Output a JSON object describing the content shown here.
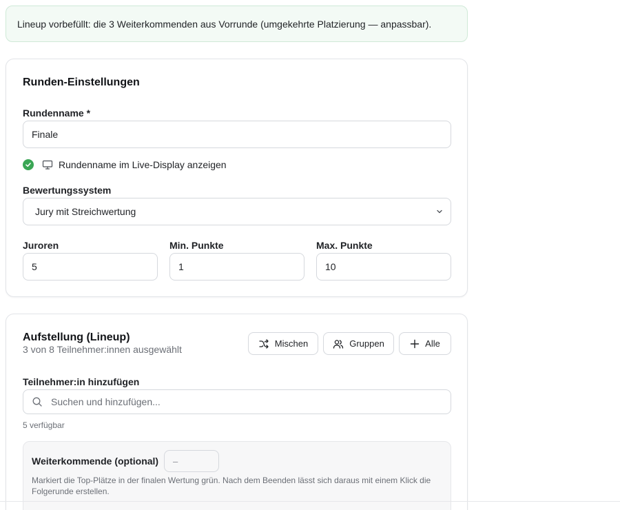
{
  "notice": {
    "text": "Lineup vorbefüllt: die 3 Weiterkommenden aus Vorrunde (umgekehrte Platzierung — anpassbar)."
  },
  "settings": {
    "title": "Runden-Einstellungen",
    "round_name_label": "Rundenname *",
    "round_name_value": "Finale",
    "show_in_display_label": "Rundenname im Live-Display anzeigen",
    "show_in_display_checked": true,
    "scoring_label": "Bewertungssystem",
    "scoring_value": "Jury mit Streichwertung",
    "judges_label": "Juroren",
    "judges_value": "5",
    "min_points_label": "Min. Punkte",
    "min_points_value": "1",
    "max_points_label": "Max. Punkte",
    "max_points_value": "10"
  },
  "lineup": {
    "title": "Aufstellung (Lineup)",
    "subtitle": "3 von 8 Teilnehmer:innen ausgewählt",
    "shuffle_label": "Mischen",
    "groups_label": "Gruppen",
    "all_label": "Alle",
    "add_label": "Teilnehmer:in hinzufügen",
    "search_placeholder": "Suchen und hinzufügen...",
    "available_text": "5 verfügbar",
    "advancing": {
      "label": "Weiterkommende (optional)",
      "value": "–",
      "help": "Markiert die Top-Plätze in der finalen Wertung grün. Nach dem Beenden lässt sich daraus mit einem Klick die Folgerunde erstellen."
    }
  },
  "colors": {
    "accent_green": "#3aa655",
    "notice_bg": "#f3faf5",
    "border": "#d5d8dd"
  },
  "icons": {
    "checkbox": "check-circle-icon",
    "display": "monitor-icon",
    "select": "chevron-down-icon",
    "shuffle": "shuffle-icon",
    "groups": "users-icon",
    "all": "plus-icon",
    "search": "search-icon"
  }
}
